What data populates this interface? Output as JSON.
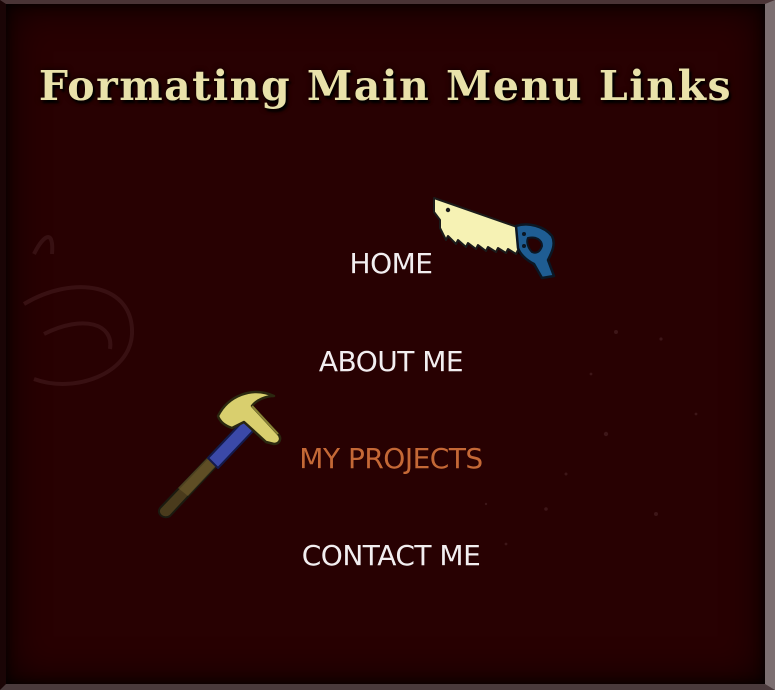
{
  "page": {
    "title": "Formating Main Menu Links"
  },
  "menu": {
    "items": [
      {
        "label": "HOME",
        "active": false
      },
      {
        "label": "ABOUT ME",
        "active": false
      },
      {
        "label": "MY PROJECTS",
        "active": true
      },
      {
        "label": "CONTACT ME",
        "active": false
      }
    ]
  },
  "icons": {
    "saw": "hand-saw-icon",
    "hammer": "hammer-icon"
  },
  "colors": {
    "background": "#280102",
    "title": "#e9e2aa",
    "menu_text": "#f2eef0",
    "menu_active": "#c46836",
    "saw_blade": "#f6f2b4",
    "saw_handle": "#1f5d93",
    "hammer_head": "#d9cf6e",
    "hammer_handle": "#3b49a8"
  }
}
